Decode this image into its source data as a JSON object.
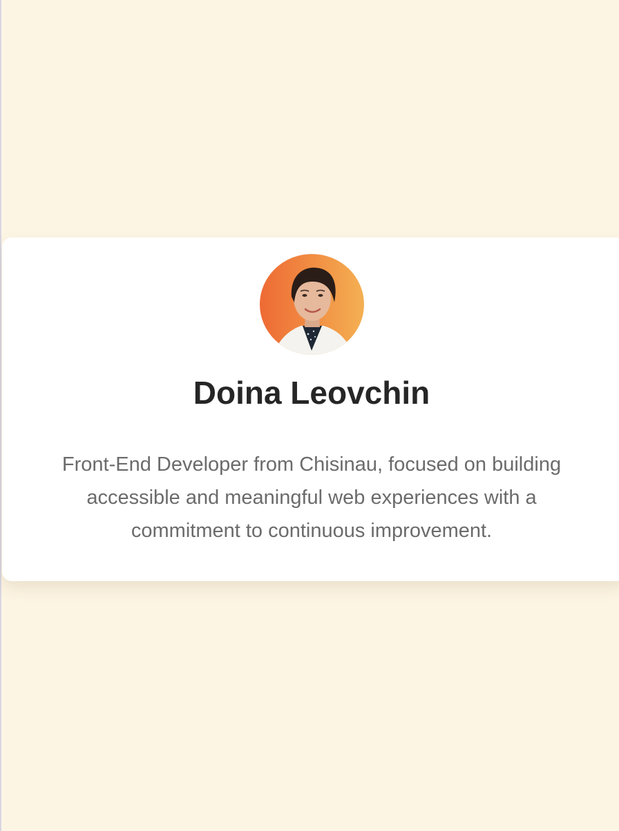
{
  "profile": {
    "name": "Doina Leovchin",
    "bio": "Front-End Developer from Chisinau, focused on building accessible and meaningful web experiences with a commitment to continuous improvement.",
    "avatar_icon": "profile-photo"
  },
  "colors": {
    "page_background": "#fdf5e4",
    "card_background": "#ffffff",
    "name_text": "#262626",
    "bio_text": "#6b6b6b",
    "avatar_gradient_start": "#ee6a34",
    "avatar_gradient_end": "#f4b052"
  }
}
